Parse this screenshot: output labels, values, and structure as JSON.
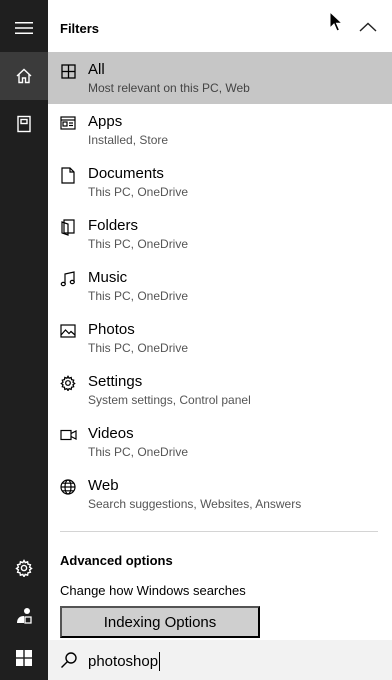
{
  "header": {
    "title": "Filters"
  },
  "rail": {
    "items": [
      {
        "icon": "hamburger-menu-icon"
      },
      {
        "icon": "home-icon",
        "active": true
      },
      {
        "icon": "notebook-icon"
      },
      {
        "icon": "gear-icon"
      },
      {
        "icon": "feedback-icon"
      }
    ]
  },
  "filters": [
    {
      "label": "All",
      "sub": "Most relevant on this PC, Web",
      "icon": "grid-icon",
      "selected": true
    },
    {
      "label": "Apps",
      "sub": "Installed, Store",
      "icon": "app-window-icon"
    },
    {
      "label": "Documents",
      "sub": "This PC, OneDrive",
      "icon": "document-icon"
    },
    {
      "label": "Folders",
      "sub": "This PC, OneDrive",
      "icon": "folder-icon"
    },
    {
      "label": "Music",
      "sub": "This PC, OneDrive",
      "icon": "music-note-icon"
    },
    {
      "label": "Photos",
      "sub": "This PC, OneDrive",
      "icon": "photo-icon"
    },
    {
      "label": "Settings",
      "sub": "System settings, Control panel",
      "icon": "gear-icon"
    },
    {
      "label": "Videos",
      "sub": "This PC, OneDrive",
      "icon": "video-camera-icon"
    },
    {
      "label": "Web",
      "sub": "Search suggestions, Websites, Answers",
      "icon": "globe-icon"
    }
  ],
  "advanced": {
    "title": "Advanced options",
    "text": "Change how Windows searches",
    "button_label": "Indexing Options"
  },
  "search": {
    "query": "photoshop"
  }
}
